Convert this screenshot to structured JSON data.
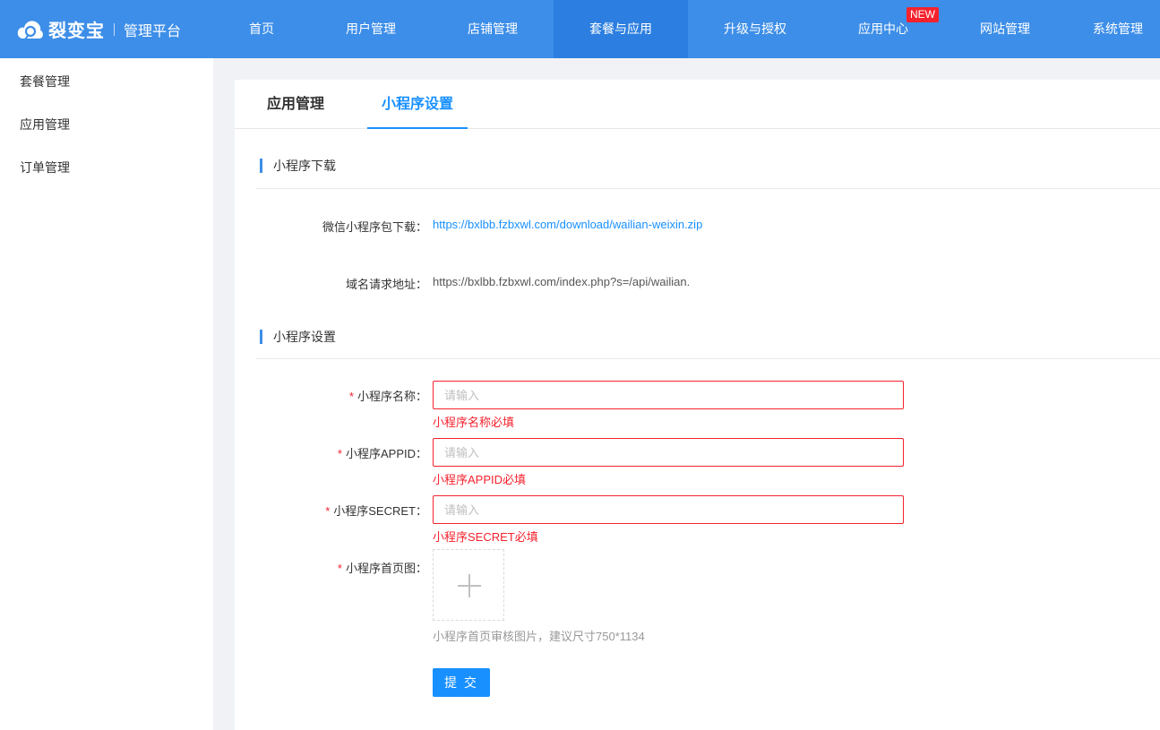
{
  "brand": {
    "name": "裂变宝",
    "subtitle": "管理平台"
  },
  "nav": {
    "items": [
      {
        "label": "首页"
      },
      {
        "label": "用户管理"
      },
      {
        "label": "店铺管理"
      },
      {
        "label": "套餐与应用",
        "active": true
      },
      {
        "label": "升级与授权"
      },
      {
        "label": "应用中心",
        "badge": "NEW"
      },
      {
        "label": "网站管理"
      },
      {
        "label": "系统管理"
      }
    ]
  },
  "sidebar": {
    "items": [
      {
        "label": "套餐管理"
      },
      {
        "label": "应用管理"
      },
      {
        "label": "订单管理"
      }
    ]
  },
  "tabs": [
    {
      "label": "应用管理"
    },
    {
      "label": "小程序设置",
      "active": true
    }
  ],
  "download_section": {
    "title": "小程序下载",
    "package_label": "微信小程序包下载：",
    "package_url": "https://bxlbb.fzbxwl.com/download/wailian-weixin.zip",
    "domain_label": "域名请求地址：",
    "domain_url": "https://bxlbb.fzbxwl.com/index.php?s=/api/wailian."
  },
  "settings_section": {
    "title": "小程序设置",
    "required_mark": "*",
    "fields": {
      "name": {
        "label": "小程序名称：",
        "placeholder": "请输入",
        "value": "",
        "error": "小程序名称必填"
      },
      "appid": {
        "label": "小程序APPID：",
        "placeholder": "请输入",
        "value": "",
        "error": "小程序APPID必填"
      },
      "secret": {
        "label": "小程序SECRET：",
        "placeholder": "请输入",
        "value": "",
        "error": "小程序SECRET必填"
      },
      "homepage_image": {
        "label": "小程序首页图：",
        "hint": "小程序首页审核图片，建议尺寸750*1134",
        "icon": "plus-icon"
      }
    },
    "submit_label": "提 交"
  },
  "colors": {
    "header_bg": "#3d8ee8",
    "nav_active_bg": "#2c7fe0",
    "primary": "#1890ff",
    "error": "#f5222d",
    "badge": "#f5222d"
  }
}
